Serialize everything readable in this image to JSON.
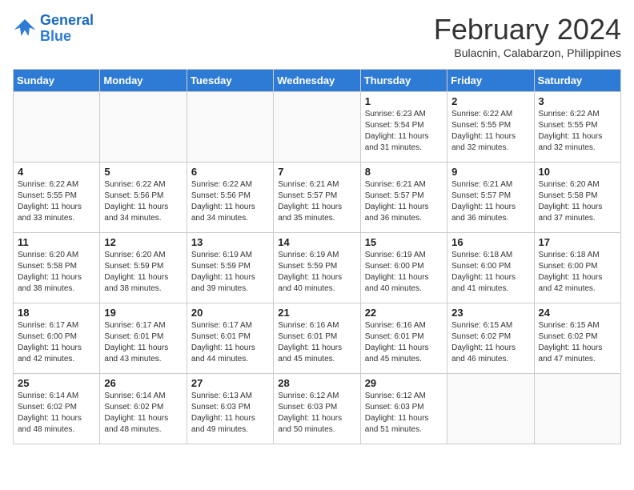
{
  "logo": {
    "line1": "General",
    "line2": "Blue"
  },
  "title": "February 2024",
  "subtitle": "Bulacnin, Calabarzon, Philippines",
  "days_of_week": [
    "Sunday",
    "Monday",
    "Tuesday",
    "Wednesday",
    "Thursday",
    "Friday",
    "Saturday"
  ],
  "weeks": [
    [
      {
        "day": "",
        "info": ""
      },
      {
        "day": "",
        "info": ""
      },
      {
        "day": "",
        "info": ""
      },
      {
        "day": "",
        "info": ""
      },
      {
        "day": "1",
        "info": "Sunrise: 6:23 AM\nSunset: 5:54 PM\nDaylight: 11 hours and 31 minutes."
      },
      {
        "day": "2",
        "info": "Sunrise: 6:22 AM\nSunset: 5:55 PM\nDaylight: 11 hours and 32 minutes."
      },
      {
        "day": "3",
        "info": "Sunrise: 6:22 AM\nSunset: 5:55 PM\nDaylight: 11 hours and 32 minutes."
      }
    ],
    [
      {
        "day": "4",
        "info": "Sunrise: 6:22 AM\nSunset: 5:55 PM\nDaylight: 11 hours and 33 minutes."
      },
      {
        "day": "5",
        "info": "Sunrise: 6:22 AM\nSunset: 5:56 PM\nDaylight: 11 hours and 34 minutes."
      },
      {
        "day": "6",
        "info": "Sunrise: 6:22 AM\nSunset: 5:56 PM\nDaylight: 11 hours and 34 minutes."
      },
      {
        "day": "7",
        "info": "Sunrise: 6:21 AM\nSunset: 5:57 PM\nDaylight: 11 hours and 35 minutes."
      },
      {
        "day": "8",
        "info": "Sunrise: 6:21 AM\nSunset: 5:57 PM\nDaylight: 11 hours and 36 minutes."
      },
      {
        "day": "9",
        "info": "Sunrise: 6:21 AM\nSunset: 5:57 PM\nDaylight: 11 hours and 36 minutes."
      },
      {
        "day": "10",
        "info": "Sunrise: 6:20 AM\nSunset: 5:58 PM\nDaylight: 11 hours and 37 minutes."
      }
    ],
    [
      {
        "day": "11",
        "info": "Sunrise: 6:20 AM\nSunset: 5:58 PM\nDaylight: 11 hours and 38 minutes."
      },
      {
        "day": "12",
        "info": "Sunrise: 6:20 AM\nSunset: 5:59 PM\nDaylight: 11 hours and 38 minutes."
      },
      {
        "day": "13",
        "info": "Sunrise: 6:19 AM\nSunset: 5:59 PM\nDaylight: 11 hours and 39 minutes."
      },
      {
        "day": "14",
        "info": "Sunrise: 6:19 AM\nSunset: 5:59 PM\nDaylight: 11 hours and 40 minutes."
      },
      {
        "day": "15",
        "info": "Sunrise: 6:19 AM\nSunset: 6:00 PM\nDaylight: 11 hours and 40 minutes."
      },
      {
        "day": "16",
        "info": "Sunrise: 6:18 AM\nSunset: 6:00 PM\nDaylight: 11 hours and 41 minutes."
      },
      {
        "day": "17",
        "info": "Sunrise: 6:18 AM\nSunset: 6:00 PM\nDaylight: 11 hours and 42 minutes."
      }
    ],
    [
      {
        "day": "18",
        "info": "Sunrise: 6:17 AM\nSunset: 6:00 PM\nDaylight: 11 hours and 42 minutes."
      },
      {
        "day": "19",
        "info": "Sunrise: 6:17 AM\nSunset: 6:01 PM\nDaylight: 11 hours and 43 minutes."
      },
      {
        "day": "20",
        "info": "Sunrise: 6:17 AM\nSunset: 6:01 PM\nDaylight: 11 hours and 44 minutes."
      },
      {
        "day": "21",
        "info": "Sunrise: 6:16 AM\nSunset: 6:01 PM\nDaylight: 11 hours and 45 minutes."
      },
      {
        "day": "22",
        "info": "Sunrise: 6:16 AM\nSunset: 6:01 PM\nDaylight: 11 hours and 45 minutes."
      },
      {
        "day": "23",
        "info": "Sunrise: 6:15 AM\nSunset: 6:02 PM\nDaylight: 11 hours and 46 minutes."
      },
      {
        "day": "24",
        "info": "Sunrise: 6:15 AM\nSunset: 6:02 PM\nDaylight: 11 hours and 47 minutes."
      }
    ],
    [
      {
        "day": "25",
        "info": "Sunrise: 6:14 AM\nSunset: 6:02 PM\nDaylight: 11 hours and 48 minutes."
      },
      {
        "day": "26",
        "info": "Sunrise: 6:14 AM\nSunset: 6:02 PM\nDaylight: 11 hours and 48 minutes."
      },
      {
        "day": "27",
        "info": "Sunrise: 6:13 AM\nSunset: 6:03 PM\nDaylight: 11 hours and 49 minutes."
      },
      {
        "day": "28",
        "info": "Sunrise: 6:12 AM\nSunset: 6:03 PM\nDaylight: 11 hours and 50 minutes."
      },
      {
        "day": "29",
        "info": "Sunrise: 6:12 AM\nSunset: 6:03 PM\nDaylight: 11 hours and 51 minutes."
      },
      {
        "day": "",
        "info": ""
      },
      {
        "day": "",
        "info": ""
      }
    ]
  ]
}
